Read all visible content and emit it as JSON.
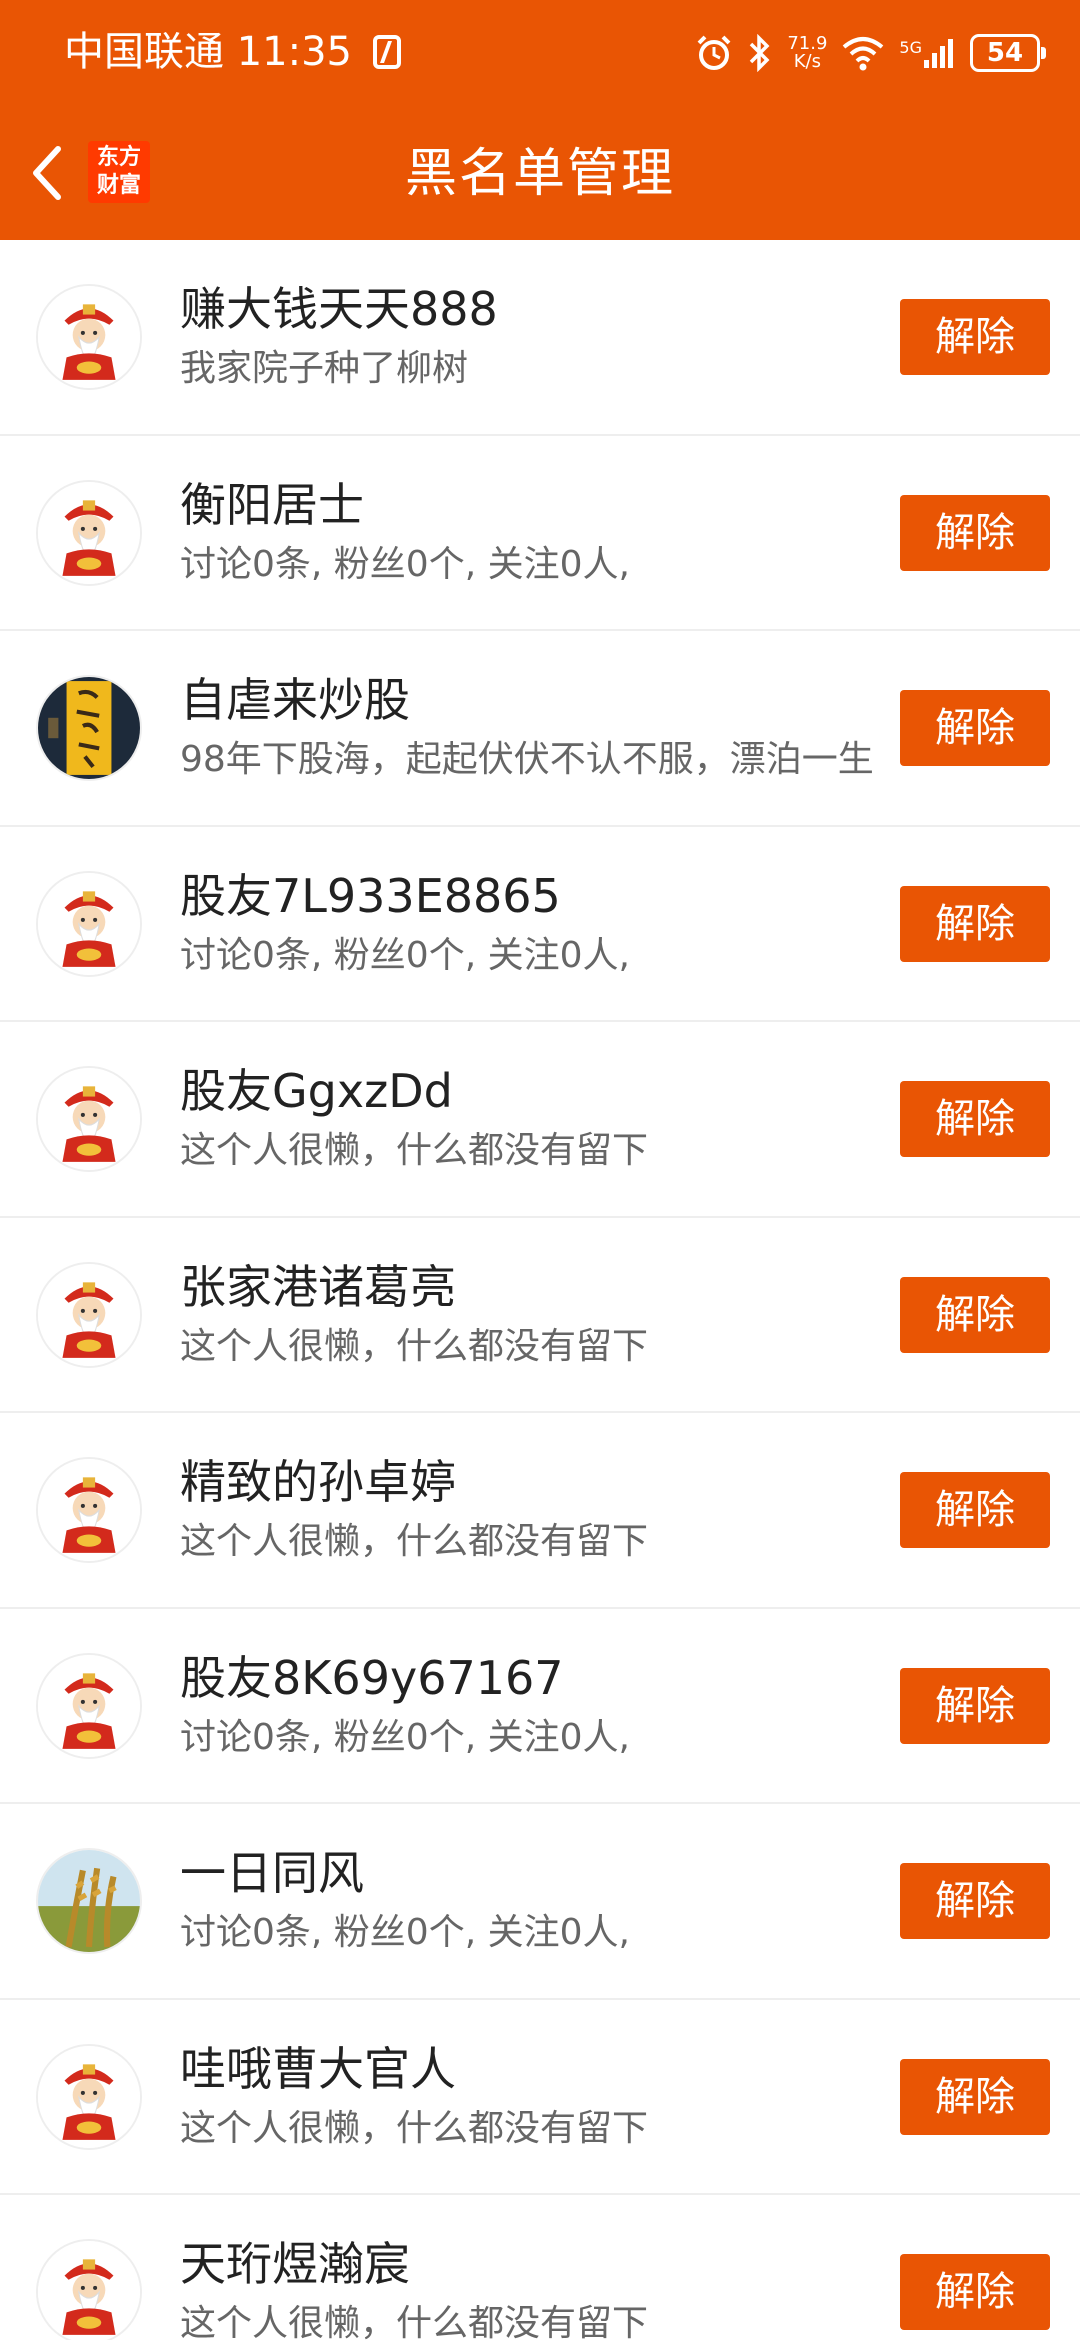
{
  "status_bar": {
    "carrier": "中国联通",
    "time": "11:35",
    "network_speed_value": "71.9",
    "network_speed_unit": "K/s",
    "signal_label": "5G",
    "battery": "54"
  },
  "header": {
    "title": "黑名单管理",
    "logo_line1": "东方",
    "logo_line2": "财富",
    "background_color": "#e95504"
  },
  "blacklist": {
    "button_label": "解除",
    "users": [
      {
        "name": "赚大钱天天888",
        "bio": "我家院子种了柳树",
        "avatar": "caishen"
      },
      {
        "name": "衡阳居士",
        "bio": "讨论0条, 粉丝0个, 关注0人,",
        "avatar": "caishen"
      },
      {
        "name": "自虐来炒股",
        "bio": "98年下股海，起起伏伏不认不服，漂泊一生",
        "avatar": "calligraphy"
      },
      {
        "name": "股友7L933E8865",
        "bio": "讨论0条, 粉丝0个, 关注0人,",
        "avatar": "caishen"
      },
      {
        "name": "股友GgxzDd",
        "bio": "这个人很懒，什么都没有留下",
        "avatar": "caishen"
      },
      {
        "name": "张家港诸葛亮",
        "bio": "这个人很懒，什么都没有留下",
        "avatar": "caishen"
      },
      {
        "name": "精致的孙卓婷",
        "bio": "这个人很懒，什么都没有留下",
        "avatar": "caishen"
      },
      {
        "name": "股友8K69y67167",
        "bio": "讨论0条, 粉丝0个, 关注0人,",
        "avatar": "caishen"
      },
      {
        "name": "一日同风",
        "bio": "讨论0条, 粉丝0个, 关注0人,",
        "avatar": "grain"
      },
      {
        "name": "哇哦曹大官人",
        "bio": "这个人很懒，什么都没有留下",
        "avatar": "caishen"
      },
      {
        "name": "天珩煜瀚宸",
        "bio": "这个人很懒，什么都没有留下",
        "avatar": "caishen"
      }
    ]
  }
}
